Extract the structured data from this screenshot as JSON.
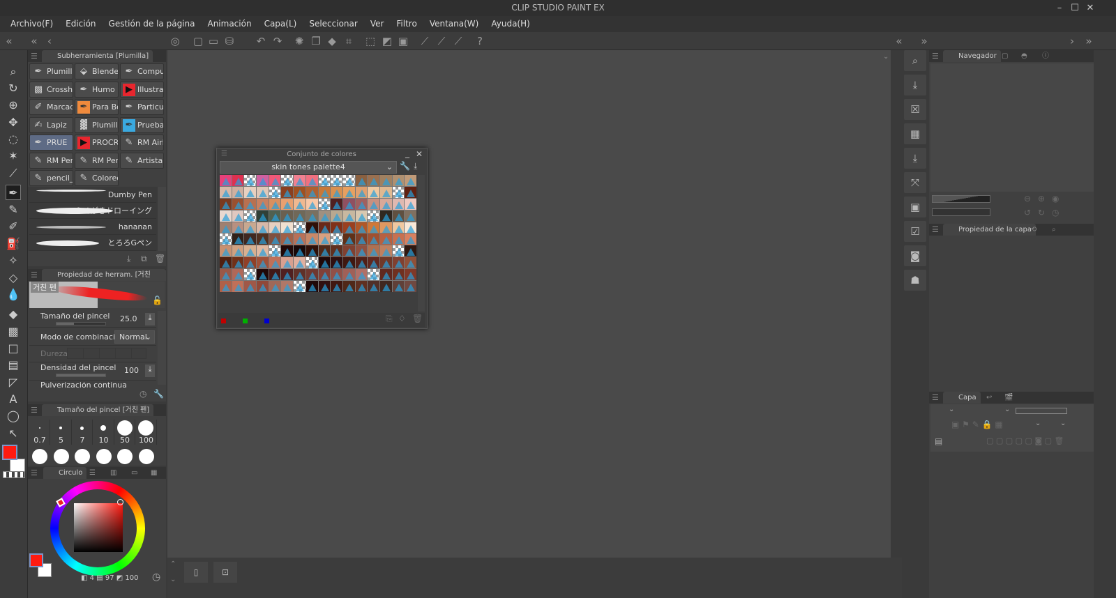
{
  "app": {
    "title": "CLIP STUDIO PAINT EX"
  },
  "window_controls": {
    "minimize": "–",
    "maximize": "☐",
    "close": "✕"
  },
  "menu": [
    "Archivo(F)",
    "Edición",
    "Gestión de la página",
    "Animación",
    "Capa(L)",
    "Seleccionar",
    "Ver",
    "Filtro",
    "Ventana(W)",
    "Ayuda(H)"
  ],
  "subtool": {
    "title": "Subherramienta [Plumilla]",
    "items": [
      {
        "label": "Plumilla",
        "icon": "pen-icon"
      },
      {
        "label": "Blender",
        "icon": "blender-icon"
      },
      {
        "label": "Compue",
        "icon": "pen-icon"
      },
      {
        "label": "Crossha",
        "icon": "crosshatch-icon"
      },
      {
        "label": "Humo",
        "icon": "pen-icon"
      },
      {
        "label": "Illustrac",
        "icon": "procreate-icon"
      },
      {
        "label": "Marcad",
        "icon": "marker-icon"
      },
      {
        "label": "Para Bo",
        "icon": "orange-pen-icon"
      },
      {
        "label": "Particul",
        "icon": "pen-icon"
      },
      {
        "label": "Lapiz",
        "icon": "text-brush-icon"
      },
      {
        "label": "Plumilla",
        "icon": "texture-icon"
      },
      {
        "label": "Pruebas",
        "icon": "blue-pen-icon"
      },
      {
        "label": "PRUE",
        "icon": "pen-icon",
        "selected": true
      },
      {
        "label": "PROCR",
        "icon": "procreate-icon"
      },
      {
        "label": "RM Airb",
        "icon": "brush-icon"
      },
      {
        "label": "RM Per",
        "icon": "brush-icon"
      },
      {
        "label": "RM Per",
        "icon": "brush-icon"
      },
      {
        "label": "Artista E",
        "icon": "brush-icon"
      },
      {
        "label": "pencil_",
        "icon": "brush-icon"
      },
      {
        "label": "Colored",
        "icon": "brush-icon"
      }
    ],
    "brushes": [
      "Dumby Pen",
      "らくがきドローイング",
      "hananan",
      "とろろGペン"
    ]
  },
  "tool_property": {
    "title": "Propiedad de herram. [거친 펜]",
    "preview_label": "거친 펜",
    "brush_size_label": "Tamaño del pincel",
    "brush_size": "25.0",
    "brush_size_fraction": 0.35,
    "blend_mode_label": "Modo de combinación",
    "blend_mode": "Normal",
    "hardness_label": "Dureza",
    "density_label": "Densidad del pincel",
    "density": "100",
    "density_fraction": 1.0,
    "continuous_label": "Pulverización continua"
  },
  "brush_size_panel": {
    "title": "Tamaño del pincel [거친 펜]",
    "sizes": [
      "0.7",
      "5",
      "7",
      "10",
      "50",
      "100"
    ]
  },
  "color_panel": {
    "tab": "Circulo",
    "main_color": "#ff1a10",
    "sub_color": "#ffffff",
    "h": "4",
    "s": "97",
    "v": "100"
  },
  "palette": {
    "title": "Conjunto de colores",
    "name": "skin tones palette4",
    "footer_colors": [
      "#c00000",
      "#00b000",
      "#0000d0"
    ],
    "colors": [
      "#e8407a",
      "#e03050",
      "T",
      "#d060a0",
      "#f05878",
      "T",
      "#f08090",
      "#f07080",
      "T",
      "T",
      "T",
      "#8a6040",
      "#9a7050",
      "#a08060",
      "#b09070",
      "#c09a78",
      "#d8b8a8",
      "#d0b0a0",
      "#e8d0c0",
      "#e0c8b8",
      "T",
      "#8a4020",
      "#a05020",
      "#b06030",
      "#c87838",
      "#d89050",
      "#e8a060",
      "#e0a070",
      "#f0c8a0",
      "#e0b890",
      "T",
      "#602010",
      "#7a3a20",
      "#9a5030",
      "#b87050",
      "#c88060",
      "#d89060",
      "#e8a070",
      "#f0b890",
      "#f8c8a8",
      "T",
      "#502020",
      "#905060",
      "#a06060",
      "#c89080",
      "#d8a898",
      "#e0b8b0",
      "#f0c8c0",
      "#e8d8d0",
      "#e0c8c0",
      "T",
      "#304038",
      "#506050",
      "#6a6050",
      "#706858",
      "#7a7060",
      "#a09080",
      "#b8a890",
      "#c8b8a0",
      "#d8c8b0",
      "T",
      "#302820",
      "#605040",
      "#807060",
      "#a08070",
      "#b89080",
      "#c8a890",
      "#d8b8a8",
      "#e8d0c0",
      "#f0e0d0",
      "T",
      "#301008",
      "#6a2818",
      "#803018",
      "#9a4020",
      "#b05828",
      "#d07838",
      "#e09860",
      "#f0c8a0",
      "#f8e8d8",
      "T",
      "#302018",
      "#402820",
      "#503020",
      "#805040",
      "#a06048",
      "#b87058",
      "#c88868",
      "#d8a080",
      "T",
      "#603018",
      "#804028",
      "#a05030",
      "#b86040",
      "#c87050",
      "#d88060",
      "#c89070",
      "#d0a080",
      "#d8b090",
      "#e0b8a0",
      "T",
      "#200808",
      "#180808",
      "#301008",
      "#502818",
      "#603020",
      "#804030",
      "#905040",
      "#b07050",
      "#c08060",
      "T",
      "#301810",
      "#502010",
      "#703018",
      "#904028",
      "#a05038",
      "#c07058",
      "#d8a090",
      "#e0b0a0",
      "T",
      "#200808",
      "#301010",
      "#401810",
      "#502018",
      "#602820",
      "#703828",
      "#804030",
      "#905038",
      "#9a5848",
      "#b06858",
      "T",
      "#200808",
      "#401818",
      "#502020",
      "#603028",
      "#703830",
      "#804038",
      "#905048",
      "#a06058",
      "#b07068",
      "T",
      "#602820",
      "#703020",
      "#803828",
      "#b06048",
      "#c07058",
      "#a05848",
      "#904838",
      "#a06858",
      "#b07868",
      "T",
      "#200808",
      "#301010",
      "#401810",
      "#502818",
      "#603020",
      "#503028",
      "#402820",
      "#604038",
      "#704840"
    ]
  },
  "navigator": {
    "tab": "Navegador"
  },
  "layer_property": {
    "tab": "Propiedad de la capa"
  },
  "layer": {
    "tab": "Capa"
  }
}
